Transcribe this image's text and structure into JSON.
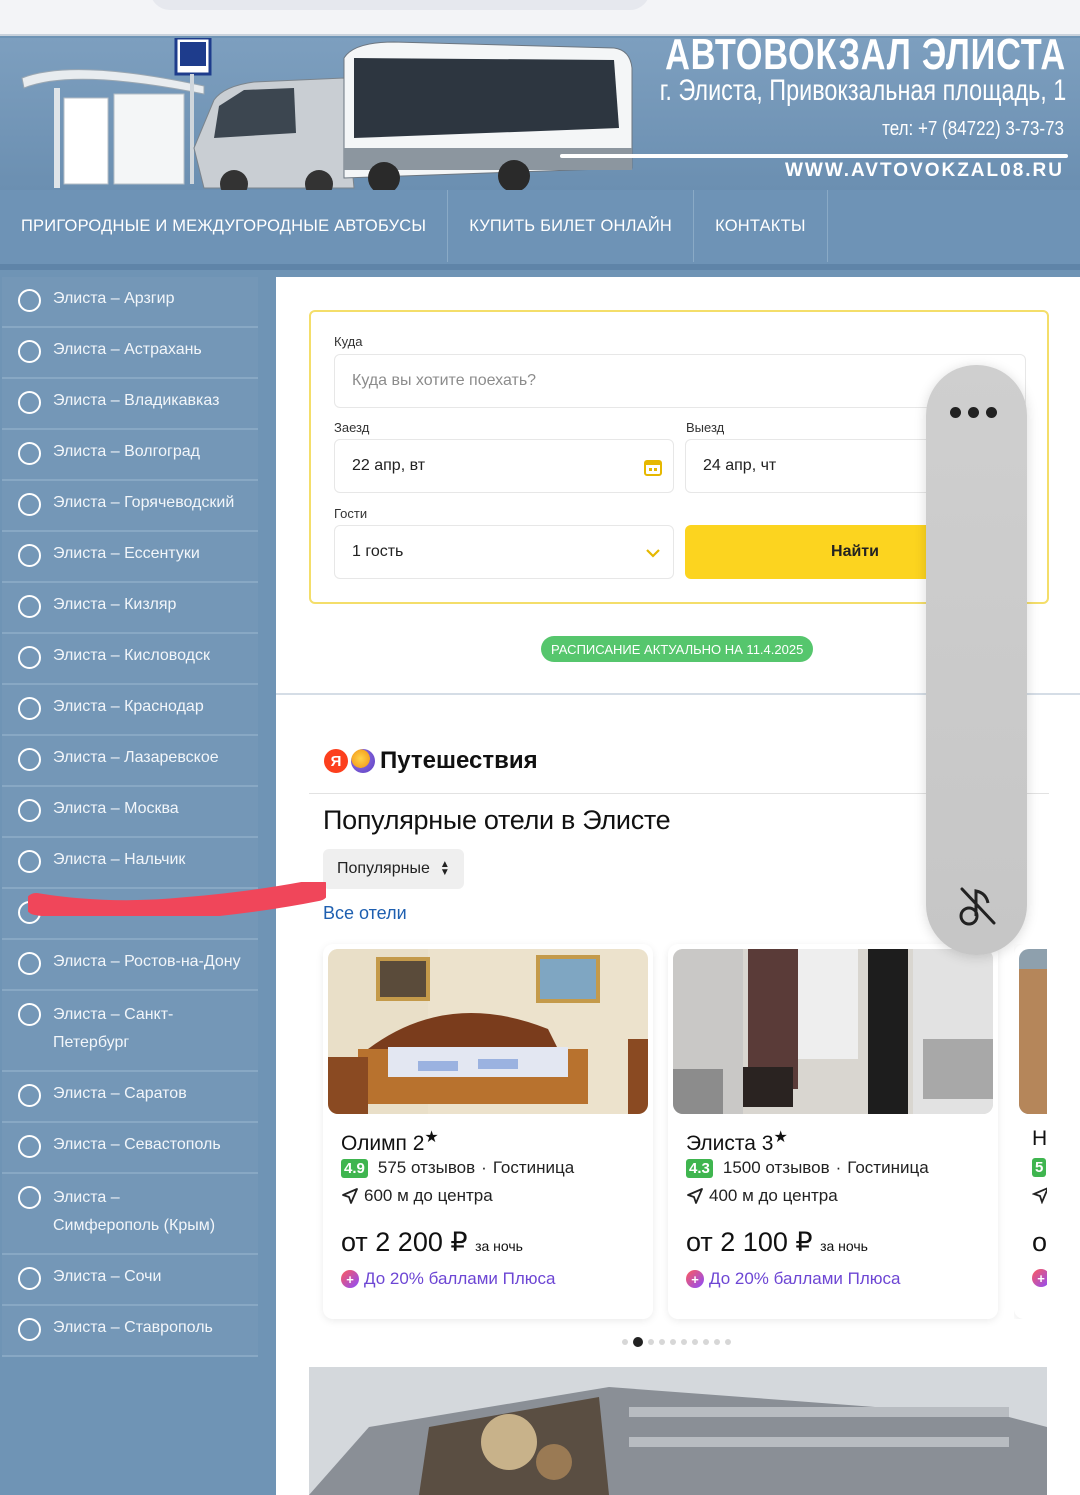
{
  "banner": {
    "title": "АВТОВОКЗАЛ ЭЛИСТА",
    "address": "г. Элиста, Привокзальная площадь, 1",
    "phone": "тел: +7 (84722) 3-73-73",
    "website": "WWW.AVTOVOKZAL08.RU"
  },
  "nav": {
    "items": [
      {
        "label": "ПРИГОРОДНЫЕ И МЕЖДУГОРОДНЫЕ АВТОБУСЫ"
      },
      {
        "label": "КУПИТЬ БИЛЕТ ОНЛАЙН"
      },
      {
        "label": "КОНТАКТЫ"
      }
    ]
  },
  "sidebar": {
    "items": [
      {
        "label": "Элиста – Арзгир"
      },
      {
        "label": "Элиста – Астрахань"
      },
      {
        "label": "Элиста – Владикавказ"
      },
      {
        "label": "Элиста – Волгоград"
      },
      {
        "label": "Элиста – Горячеводский"
      },
      {
        "label": "Элиста – Ессентуки"
      },
      {
        "label": "Элиста – Кизляр"
      },
      {
        "label": "Элиста – Кисловодск"
      },
      {
        "label": "Элиста – Краснодар"
      },
      {
        "label": "Элиста – Лазаревское"
      },
      {
        "label": "Элиста – Москва"
      },
      {
        "label": "Элиста – Нальчик"
      },
      {
        "label": ""
      },
      {
        "label": "Элиста – Ростов-на-Дону"
      },
      {
        "label": "Элиста – Санкт-Петербург"
      },
      {
        "label": "Элиста – Саратов"
      },
      {
        "label": "Элиста – Севастополь"
      },
      {
        "label": "Элиста – Симферополь (Крым)"
      },
      {
        "label": "Элиста – Сочи"
      },
      {
        "label": "Элиста – Ставрополь"
      }
    ]
  },
  "search": {
    "where_label": "Куда",
    "where_placeholder": "Куда вы хотите поехать?",
    "checkin_label": "Заезд",
    "checkin_value": "22 апр, вт",
    "checkout_label": "Выезд",
    "checkout_value": "24 апр, чт",
    "guests_label": "Гости",
    "guests_value": "1 гость",
    "find_label": "Найти"
  },
  "schedule_badge": "РАСПИСАНИЕ АКТУАЛЬНО НА 11.4.2025",
  "travel": {
    "logo_letter": "Я",
    "brand": "Путешествия",
    "title": "Популярные отели в Элисте",
    "sort_label": "Популярные",
    "all_hotels": "Все отели"
  },
  "hotels": [
    {
      "name": "Олимп 2",
      "stars": "★",
      "rating": "4.9",
      "reviews": "575 отзывов",
      "type": "Гостиница",
      "distance": "600 м до центра",
      "price": "от 2 200 ₽",
      "per_night": "за ночь",
      "plus": "До 20% баллами Плюса"
    },
    {
      "name": "Элиста 3",
      "stars": "★",
      "rating": "4.3",
      "reviews": "1500 отзывов",
      "type": "Гостиница",
      "distance": "400 м до центра",
      "price": "от 2 100 ₽",
      "per_night": "за ночь",
      "plus": "До 20% баллами Плюса"
    },
    {
      "name": "Н",
      "rating": "5",
      "price": "о"
    }
  ],
  "colors": {
    "header_blue": "#6f94b5",
    "accent_yellow": "#fcd41f",
    "badge_green": "#56c66d",
    "link_blue": "#1e5fb0",
    "plus_purple": "#6d46d4"
  }
}
